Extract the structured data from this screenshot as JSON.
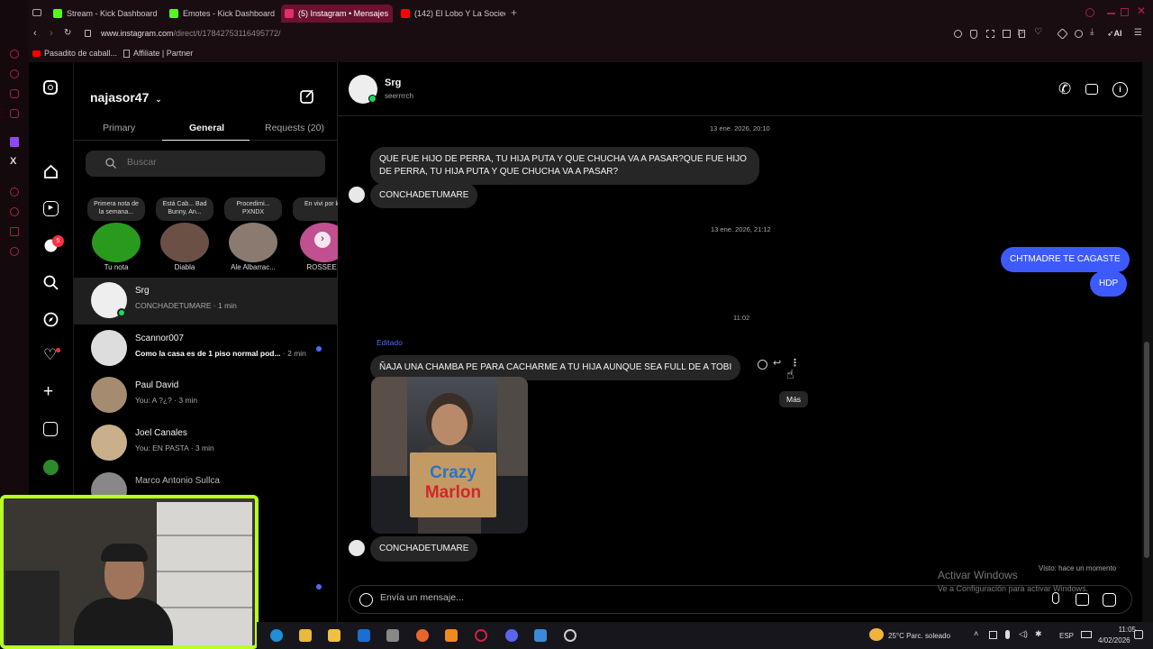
{
  "browser": {
    "tabs": [
      {
        "label": "Stream - Kick Dashboard",
        "color": "#53fc18"
      },
      {
        "label": "Emotes - Kick Dashboard",
        "color": "#53fc18"
      },
      {
        "label": "(5) Instagram • Mensajes",
        "color": "#e1306c"
      },
      {
        "label": "(142) El Lobo Y La Socieda",
        "color": "#ff0000"
      }
    ],
    "url_host": "www.instagram.com",
    "url_path": "/direct/t/17842753116495772/",
    "ai_label": "AI",
    "bookmarks": [
      {
        "label": "Pasadito de caball..."
      },
      {
        "label": "Affiliate | Partner"
      }
    ]
  },
  "nav": {
    "badge_count": "5"
  },
  "inbox": {
    "username": "najasor47",
    "tabs": [
      {
        "label": "Primary"
      },
      {
        "label": "General"
      },
      {
        "label": "Requests (20)"
      }
    ],
    "search_placeholder": "Buscar",
    "notes": [
      {
        "bubble": "Primera nota de la semana...",
        "name": "Tu nota"
      },
      {
        "bubble": "Está Cab... Bad Bunny, An...",
        "name": "Diabla"
      },
      {
        "bubble": "Procedimi... PXNDX",
        "name": "Ale Albarrac..."
      },
      {
        "bubble": "En vivi por k",
        "name": "ROSSEE"
      }
    ],
    "threads": [
      {
        "name": "Srg",
        "preview": "CONCHADETUMARE · 1 min"
      },
      {
        "name": "Scannor007",
        "preview": "Como la casa es de 1 piso normal pod...",
        "time": "· 2 min"
      },
      {
        "name": "Paul David",
        "preview": "You: A ?¿? · 3 min"
      },
      {
        "name": "Joel Canales",
        "preview": "You: EN PASTA · 3 min"
      },
      {
        "name": "Marco Antonio Sullca",
        "preview": ""
      }
    ]
  },
  "chat": {
    "contact_name": "Srg",
    "contact_handle": "seerrrrch",
    "timestamps": [
      "13 ene. 2026, 20:10",
      "13 ene. 2026, 21:12",
      "11:02"
    ],
    "messages": [
      {
        "text": "QUE FUE HIJO DE PERRA, TU HIJA PUTA Y QUE CHUCHA VA A PASAR?QUE FUE HIJO DE PERRA, TU HIJA PUTA Y QUE CHUCHA VA A PASAR?"
      },
      {
        "text": "CONCHADETUMARE"
      },
      {
        "text": "CHTMADRE TE CAGASTE"
      },
      {
        "text": "HDP"
      },
      {
        "text": "ÑAJA UNA CHAMBA PE PARA CACHARME A TU HIJA AUNQUE SEA FULL DE A TOBI"
      },
      {
        "text": "CONCHADETUMARE"
      }
    ],
    "edited_label": "Editado",
    "image_sign_line1": "Crazy",
    "image_sign_line2": "Marlon",
    "tooltip": "Más",
    "seen": "Visto: hace un momento",
    "composer_placeholder": "Envía un mensaje..."
  },
  "watermark": {
    "title": "Activar Windows",
    "subtitle": "Ve a Configuración para activar Windows."
  },
  "taskbar": {
    "weather": "25°C  Parc. soleado",
    "lang": "ESP",
    "time": "11:05",
    "date": "4/02/2026"
  }
}
